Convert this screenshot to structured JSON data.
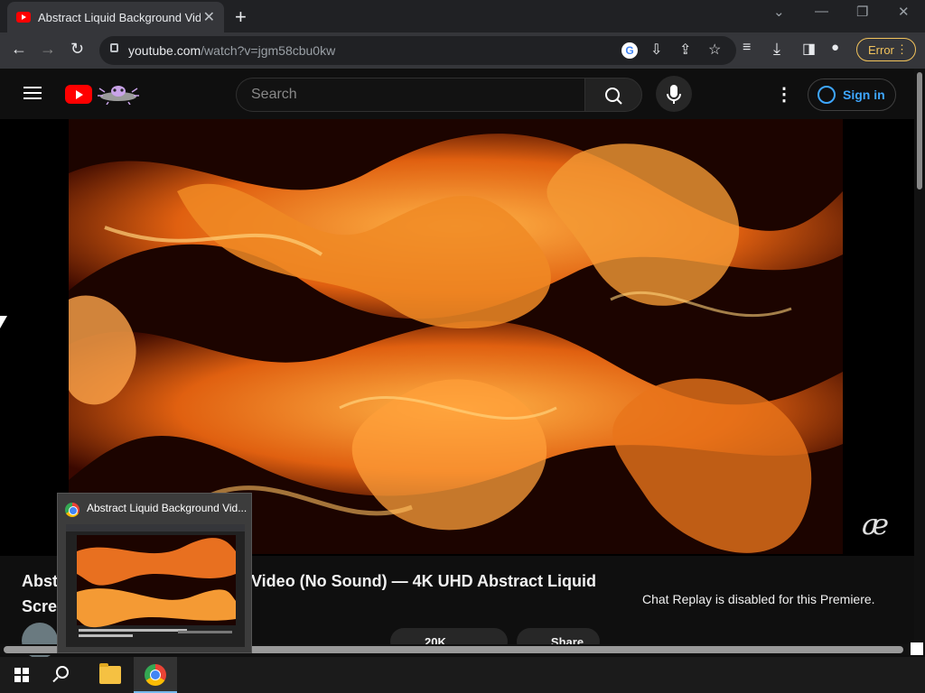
{
  "browser": {
    "tab_title": "Abstract Liquid Background Vide",
    "tab_close": "✕",
    "new_tab": "+",
    "url_host": "youtube.com",
    "url_path": "/watch?v=jgm58cbu0kw",
    "error_label": "Error",
    "error_menu": "⋮"
  },
  "youtube": {
    "search_placeholder": "Search",
    "sign_in": "Sign in",
    "more_menu": "⋮",
    "video_title": "Abstract Liquid Background Video (No Sound) — 4K UHD Abstract Liquid Screensaver",
    "title_visible_line1_start": "Abst",
    "title_visible_line1_end": "Video (No Sound) — 4K UHD Abstract Liquid",
    "title_visible_line2": "Scree",
    "chat_replay": "Chat Replay is disabled for this Premiere.",
    "watermark": "æ",
    "like_count": "20K",
    "share_label": "Share"
  },
  "preview": {
    "title": "Abstract Liquid Background Vid..."
  },
  "colors": {
    "accent": "#3ea6ff",
    "yt_red": "#ff0000",
    "error": "#f2c35c"
  }
}
